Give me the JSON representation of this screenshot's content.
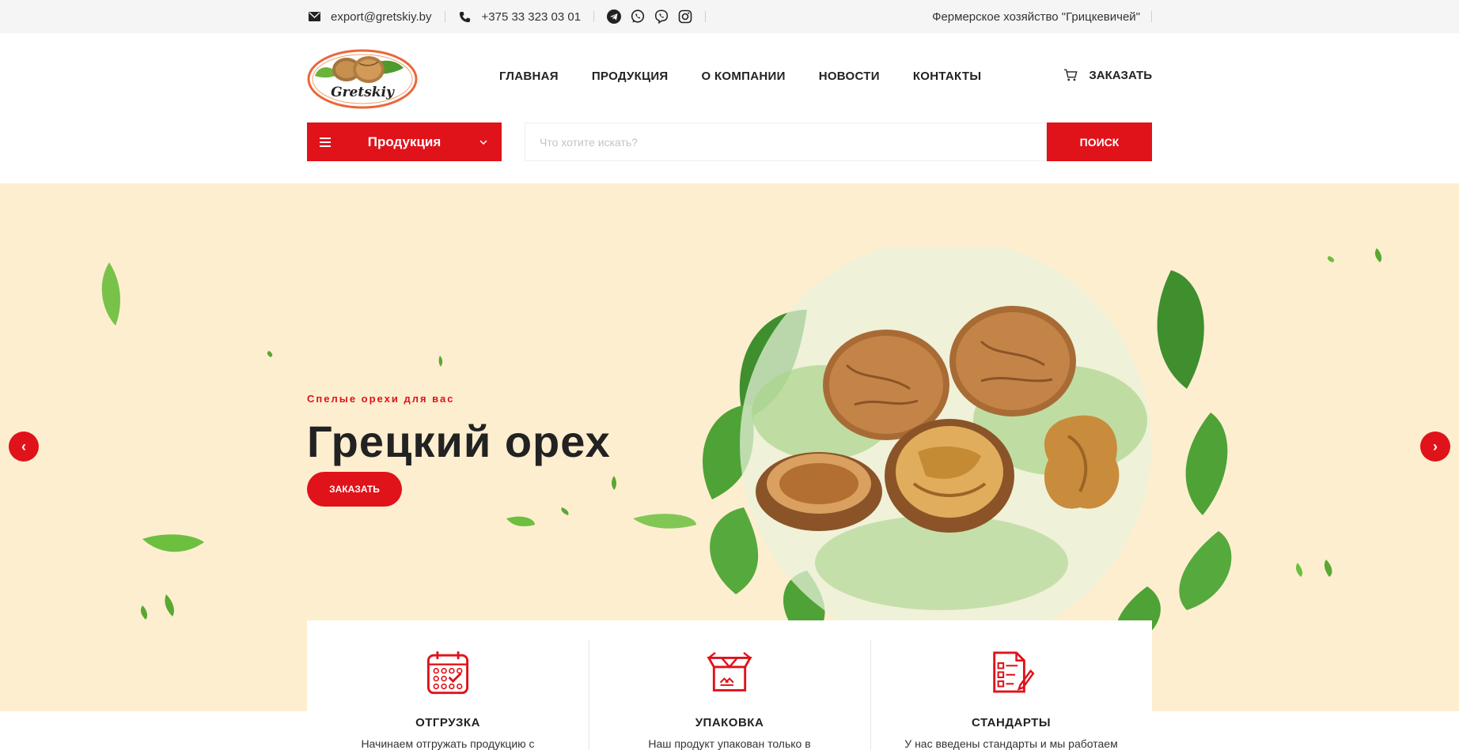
{
  "topbar": {
    "email": "export@gretskiy.by",
    "phone": "+375 33 323 03 01",
    "farm": "Фермерское хозяйство \"Грицкевичей\""
  },
  "header": {
    "logo_text": "Gretskiy",
    "nav": [
      "ГЛАВНАЯ",
      "ПРОДУКЦИЯ",
      "О КОМПАНИИ",
      "НОВОСТИ",
      "КОНТАКТЫ"
    ],
    "order_label": "ЗАКАЗАТЬ"
  },
  "search": {
    "category_label": "Продукция",
    "placeholder": "Что хотите искать?",
    "button_label": "ПОИСК"
  },
  "hero": {
    "subtitle": "Спелые орехи для вас",
    "title": "Грецкий орех",
    "button_label": "ЗАКАЗАТЬ",
    "prev_arrow": "‹",
    "next_arrow": "›"
  },
  "features": [
    {
      "title": "ОТГРУЗКА",
      "text": "Начинаем отгружать продукцию с",
      "icon": "calendar-icon"
    },
    {
      "title": "УПАКОВКА",
      "text": "Наш продукт упакован только в",
      "icon": "box-icon"
    },
    {
      "title": "СТАНДАРТЫ",
      "text": "У нас введены стандарты и мы работаем",
      "icon": "document-icon"
    }
  ],
  "colors": {
    "accent": "#e0121a",
    "hero_bg": "#fdeed0",
    "topbar_bg": "#f5f5f5"
  }
}
